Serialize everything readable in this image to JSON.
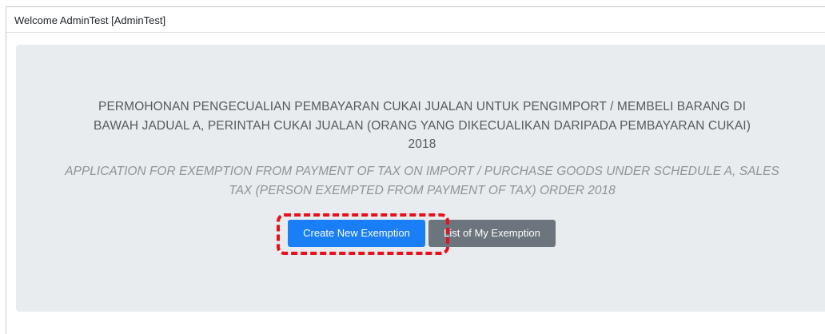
{
  "header": {
    "welcome": "Welcome AdminTest [AdminTest]"
  },
  "main": {
    "title_lines": [
      "PERMOHONAN PENGECUALIAN PEMBAYARAN CUKAI JUALAN UNTUK PENGIMPORT / MEMBELI BARANG DI",
      "BAWAH JADUAL A, PERINTAH CUKAI JUALAN (ORANG YANG DIKECUALIKAN DARIPADA PEMBAYARAN CUKAI)",
      "2018"
    ],
    "subtitle_lines": [
      "APPLICATION FOR EXEMPTION FROM PAYMENT OF TAX ON IMPORT / PURCHASE GOODS UNDER SCHEDULE A, SALES",
      "TAX (PERSON EXEMPTED FROM PAYMENT OF TAX) ORDER 2018"
    ],
    "buttons": {
      "create": "Create New Exemption",
      "list": "List of My Exemption"
    }
  },
  "colors": {
    "primary": "#1a7ef6",
    "secondary": "#6c757d",
    "panel_bg": "#e9ecef",
    "highlight": "#e8101b"
  }
}
